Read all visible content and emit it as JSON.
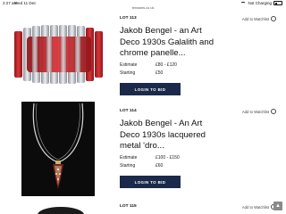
{
  "status": {
    "time": "2:27 am",
    "date": "Wed 11 Dec",
    "charging": "Not Charging"
  },
  "browser": {
    "url": "tennants.co.uk"
  },
  "lots": [
    {
      "lot_label": "LOT 113",
      "watchlist": "Add to Watchlist",
      "title": "Jakob Bengel - an Art Deco 1930s Galalith and chrome panelle...",
      "estimate_label": "Estimate",
      "estimate_value": "£80 - £120",
      "starting_label": "Starting",
      "starting_value": "£50",
      "button": "LOGIN TO BID"
    },
    {
      "lot_label": "LOT 114",
      "watchlist": "Add to Watchlist",
      "title": "Jakob Bengel - An Art Deco 1930s lacquered metal 'dro...",
      "estimate_label": "Estimate",
      "estimate_value": "£100 - £150",
      "starting_label": "Starting",
      "starting_value": "£60",
      "button": "LOGIN TO BID"
    },
    {
      "lot_label": "LOT 115",
      "watchlist": "Add to Watchlist"
    }
  ],
  "icons": [
    "wifi-icon",
    "battery-icon",
    "circle-checkbox-icon",
    "chevron-up-icon"
  ],
  "colors": {
    "button": "#1b2a4a",
    "bracelet_red": "#c0262b",
    "chrome": "#b9bcc2"
  }
}
